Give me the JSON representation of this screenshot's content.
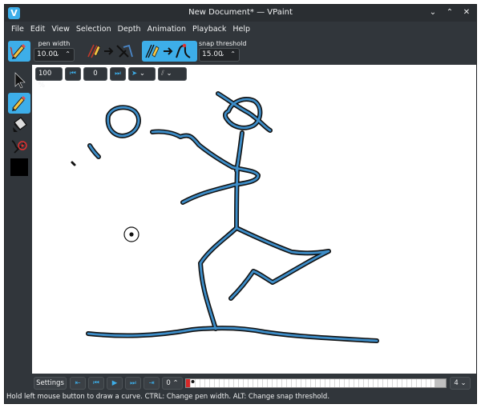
{
  "window": {
    "title": "New Document* — VPaint",
    "app_icon_letter": "V"
  },
  "window_buttons": {
    "minimize": "⌄",
    "maximize": "⌃",
    "close": "✕"
  },
  "menu": [
    "File",
    "Edit",
    "View",
    "Selection",
    "Depth",
    "Animation",
    "Playback",
    "Help"
  ],
  "toolbar": {
    "pen_width_label": "pen width",
    "pen_width_value": "10.00",
    "snap_threshold_label": "snap threshold",
    "snap_threshold_value": "15.00",
    "spin_arrows": "⌄ ⌃"
  },
  "canvas_toolbar": {
    "zoom": "100 %",
    "frame_value": "0",
    "dropdown_arrow": "⌄"
  },
  "timeline": {
    "settings_label": "Settings",
    "start_frame": "0",
    "end_frame": "4",
    "buttons": [
      "⇤",
      "⏮",
      "▶",
      "⏭",
      "⇥"
    ]
  },
  "status": "Hold left mouse button to draw a curve. CTRL: Change pen width. ALT: Change snap threshold.",
  "colors": {
    "accent": "#3daee9",
    "stroke": "#3d8dc8",
    "current_color": "#000000"
  },
  "icons": [
    "select-arrow-icon",
    "pencil-icon",
    "paint-bucket-icon",
    "sculpt-icon",
    "color-swatch-icon"
  ]
}
